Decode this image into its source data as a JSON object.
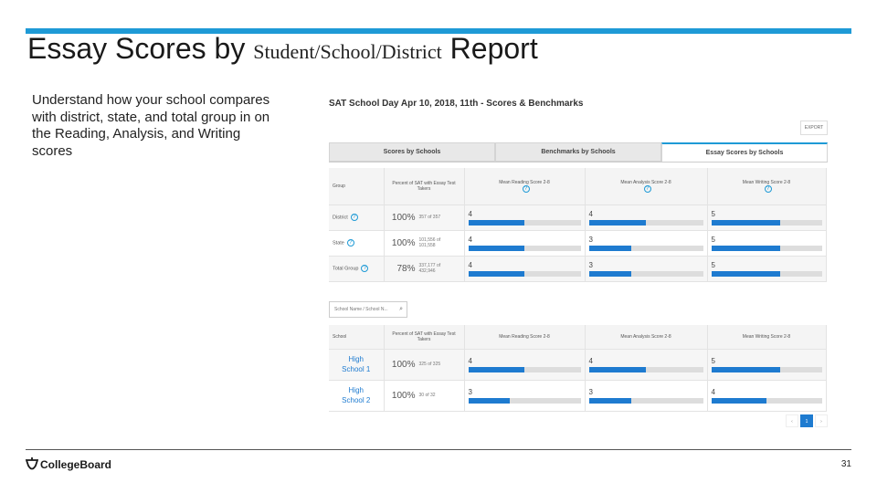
{
  "slide": {
    "title_part1": "Essay Scores by",
    "title_part2": "Student/School/District",
    "title_part3": "Report",
    "description": "Understand how your school compares with district, state, and total group in on the Reading, Analysis, and Writing scores",
    "logo_text": "CollegeBoard",
    "page_number": "31"
  },
  "screenshot": {
    "heading": "SAT School Day Apr 10, 2018, 11th - Scores & Benchmarks",
    "export_label": "EXPORT",
    "tabs": [
      "Scores by Schools",
      "Benchmarks by Schools",
      "Essay Scores by Schools"
    ],
    "active_tab": 2,
    "group_table": {
      "headers": [
        "Group",
        "Percent of SAT with Essay Test Takers",
        "Mean Reading Score 2-8",
        "Mean Analysis Score 2-8",
        "Mean Writing Score 2-8"
      ],
      "rows": [
        {
          "group": "District",
          "pct": "100%",
          "of": "357 of 357",
          "pct_value": 1.0,
          "reading": "4",
          "analysis": "4",
          "writing": "5",
          "reading_fill": 0.5,
          "analysis_fill": 0.5,
          "writing_fill": 0.62
        },
        {
          "group": "State",
          "pct": "100%",
          "of": "101,556 of 101,558",
          "pct_value": 1.0,
          "reading": "4",
          "analysis": "3",
          "writing": "5",
          "reading_fill": 0.5,
          "analysis_fill": 0.37,
          "writing_fill": 0.62
        },
        {
          "group": "Total Group",
          "pct": "78%",
          "of": "337,177 of 432,946",
          "pct_value": 0.78,
          "reading": "4",
          "analysis": "3",
          "writing": "5",
          "reading_fill": 0.5,
          "analysis_fill": 0.37,
          "writing_fill": 0.62
        }
      ]
    },
    "search_placeholder": "School Name / School N...",
    "school_table": {
      "headers": [
        "School",
        "Percent of SAT with Essay Test Takers",
        "Mean Reading Score 2-8",
        "Mean Analysis Score 2-8",
        "Mean Writing Score 2-8"
      ],
      "rows": [
        {
          "school_line1": "High",
          "school_line2": "School 1",
          "pct": "100%",
          "of": "325 of 325",
          "reading": "4",
          "analysis": "4",
          "writing": "5",
          "reading_fill": 0.5,
          "analysis_fill": 0.5,
          "writing_fill": 0.62
        },
        {
          "school_line1": "High",
          "school_line2": "School 2",
          "pct": "100%",
          "of": "30 of 32",
          "reading": "3",
          "analysis": "3",
          "writing": "4",
          "reading_fill": 0.37,
          "analysis_fill": 0.37,
          "writing_fill": 0.5
        }
      ]
    },
    "pager": [
      "‹",
      "1",
      "›"
    ]
  }
}
